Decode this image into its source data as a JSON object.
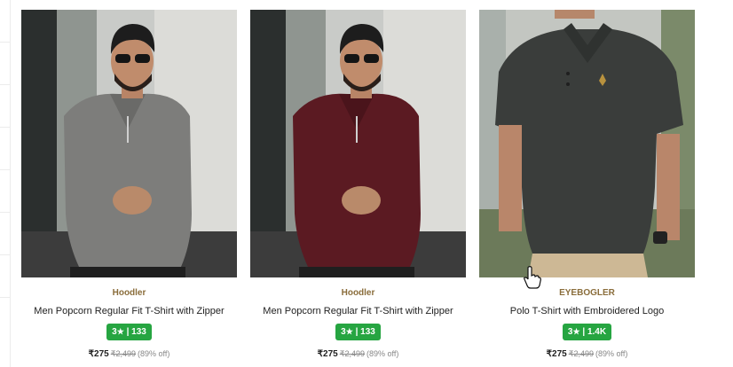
{
  "products": [
    {
      "brand": "Hoodler",
      "title": "Men Popcorn Regular Fit T-Shirt with Zipper",
      "rating": "3",
      "rating_count": "133",
      "price": "₹275",
      "mrp": "₹2,499",
      "discount": "(89% off)",
      "shirt_color": "#7d7d7b",
      "photo_icon": "product-photo"
    },
    {
      "brand": "Hoodler",
      "title": "Men Popcorn Regular Fit T-Shirt with Zipper",
      "rating": "3",
      "rating_count": "133",
      "price": "₹275",
      "mrp": "₹2,499",
      "discount": "(89% off)",
      "shirt_color": "#5b1a22",
      "photo_icon": "product-photo"
    },
    {
      "brand": "EYEBOGLER",
      "title": "Polo T-Shirt with Embroidered Logo",
      "rating": "3",
      "rating_count": "1.4K",
      "price": "₹275",
      "mrp": "₹2,499",
      "discount": "(89% off)",
      "shirt_color": "#3a3d3b",
      "photo_icon": "product-photo"
    }
  ],
  "rating_separator": "|",
  "star_glyph": "★",
  "colors": {
    "rating_badge": "#26a541",
    "brand_text": "#8a6d3b",
    "muted_text": "#878787"
  }
}
